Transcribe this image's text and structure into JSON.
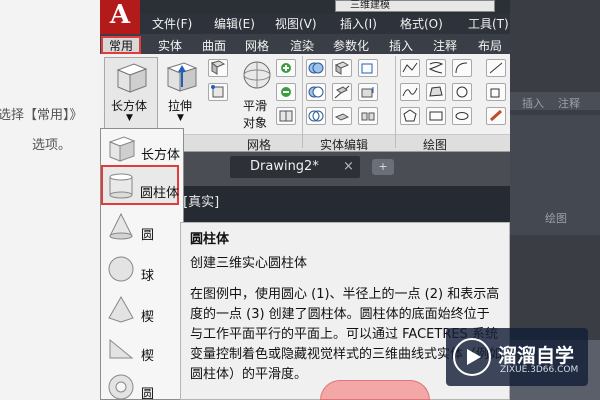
{
  "background": {
    "left_texts": [
      "选择【常用】》",
      "选项。"
    ],
    "right_tabs": [
      "插入",
      "注释"
    ],
    "right_label": "绘图"
  },
  "title": {
    "workspace": "三维建模"
  },
  "menu": [
    "文件(F)",
    "编辑(E)",
    "视图(V)",
    "插入(I)",
    "格式(O)",
    "工具(T)"
  ],
  "ribbon_tabs": [
    "常用",
    "实体",
    "曲面",
    "网格",
    "渲染",
    "参数化",
    "插入",
    "注释",
    "布局"
  ],
  "ribbon": {
    "box_label": "长方体",
    "extrude_label": "拉伸",
    "smooth_label_1": "平滑",
    "smooth_label_2": "对象",
    "panels": [
      "网格",
      "实体编辑",
      "绘图"
    ]
  },
  "document": {
    "tab": "Drawing2*",
    "viewport_label": "][真实]"
  },
  "dropdown": {
    "items": [
      "长方体",
      "圆柱体",
      "圆",
      "球",
      "楔",
      "楔",
      "圆"
    ]
  },
  "tooltip": {
    "title": "圆柱体",
    "subtitle": "创建三维实心圆柱体",
    "description": "在图例中，使用圆心 (1)、半径上的一点 (2) 和表示高度的一点 (3) 创建了圆柱体。圆柱体的底面始终位于与工作平面平行的平面上。可以通过 FACETRES 系统变量控制着色或隐藏视觉样式的三维曲线式实体（例如圆柱体）的平滑度。"
  },
  "watermark": {
    "title": "溜溜自学",
    "url": "ZIXUE.3D66.COM"
  },
  "colors": {
    "highlight": "#e23b3b",
    "dark_ui": "#2e333b",
    "ribbon": "#f1f1f1"
  }
}
